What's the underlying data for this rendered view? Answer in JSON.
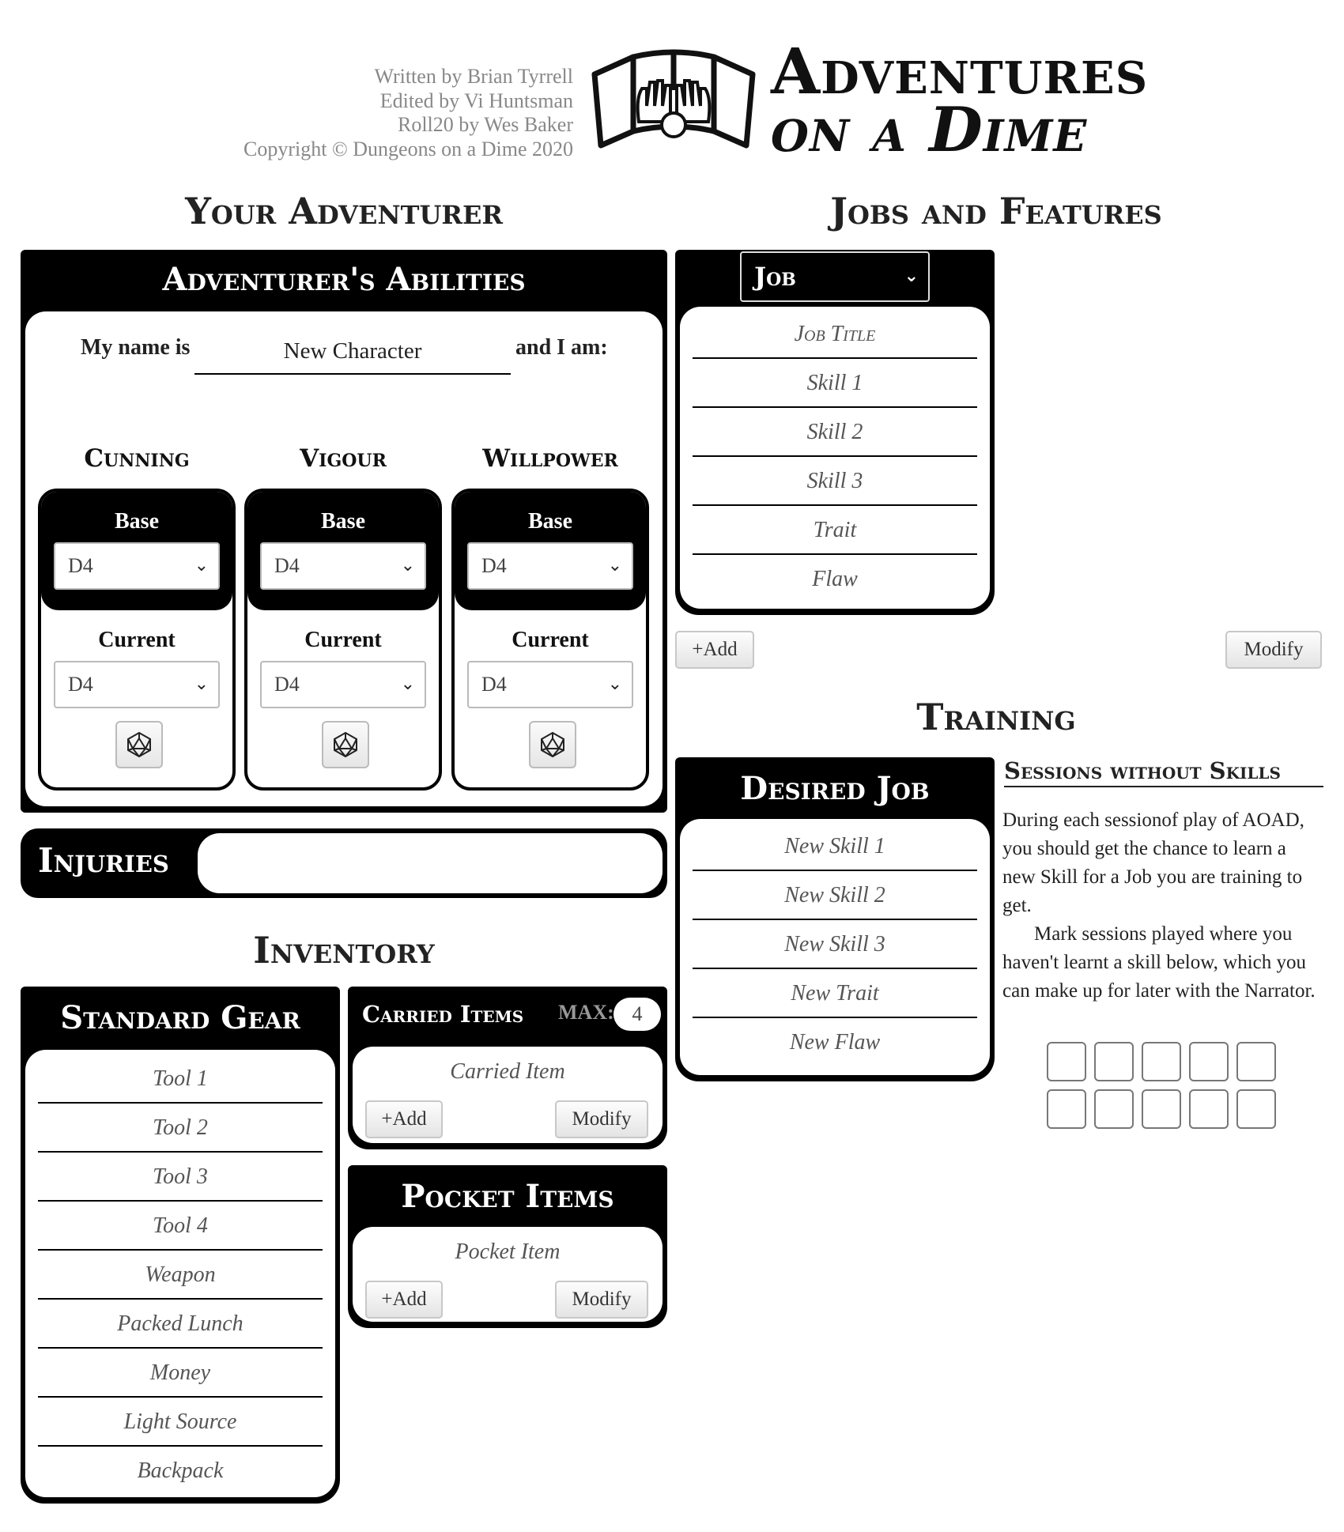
{
  "header": {
    "credits": [
      "Written by Brian Tyrrell",
      "Edited by Vi Huntsman",
      "Roll20 by Wes Baker",
      "Copyright © Dungeons on a Dime 2020"
    ],
    "brand_line1": "Adventures",
    "brand_line2": "on a Dime",
    "logo_icon": "open-book-hands-icon"
  },
  "your_adventurer": {
    "title": "Your Adventurer",
    "abilities": {
      "title": "Adventurer's Abilities",
      "name_prefix": "My name is",
      "name_value": "New Character",
      "name_suffix": "and I am:",
      "stats": [
        {
          "name": "Cunning",
          "base_label": "Base",
          "base_value": "D4",
          "current_label": "Current",
          "current_value": "D4"
        },
        {
          "name": "Vigour",
          "base_label": "Base",
          "base_value": "D4",
          "current_label": "Current",
          "current_value": "D4"
        },
        {
          "name": "Willpower",
          "base_label": "Base",
          "base_value": "D4",
          "current_label": "Current",
          "current_value": "D4"
        }
      ],
      "dice_icon": "d20-icon"
    },
    "injuries": {
      "label": "Injuries",
      "value": ""
    }
  },
  "inventory": {
    "title": "Inventory",
    "standard_gear": {
      "title": "Standard Gear",
      "items": [
        "Tool 1",
        "Tool 2",
        "Tool 3",
        "Tool 4",
        "Weapon",
        "Packed Lunch",
        "Money",
        "Light Source",
        "Backpack"
      ]
    },
    "carried": {
      "title": "Carried Items",
      "max_label": "MAX:",
      "max_value": "4",
      "item": "Carried Item",
      "add": "+Add",
      "modify": "Modify"
    },
    "pocket": {
      "title": "Pocket Items",
      "item": "Pocket Item",
      "add": "+Add",
      "modify": "Modify"
    }
  },
  "jobs": {
    "title": "Jobs and Features",
    "select_value": "Job",
    "rows": [
      "Job Title",
      "Skill 1",
      "Skill 2",
      "Skill 3",
      "Trait",
      "Flaw"
    ],
    "add": "+Add",
    "modify": "Modify"
  },
  "training": {
    "title": "Training",
    "desired_job": {
      "title": "Desired Job",
      "rows": [
        "New Skill 1",
        "New Skill 2",
        "New Skill 3",
        "New Trait",
        "New Flaw"
      ]
    },
    "sessions": {
      "title": "Sessions without Skills",
      "para1": "During each sessionof play of AOAD, you should get the chance to learn a new Skill for a Job you are training to get.",
      "para2": "Mark sessions played where you haven't learnt a skill below, which you can make up for later with the Narrator.",
      "checked": [
        false,
        false,
        false,
        false,
        false,
        false,
        false,
        false,
        false,
        false
      ]
    }
  }
}
